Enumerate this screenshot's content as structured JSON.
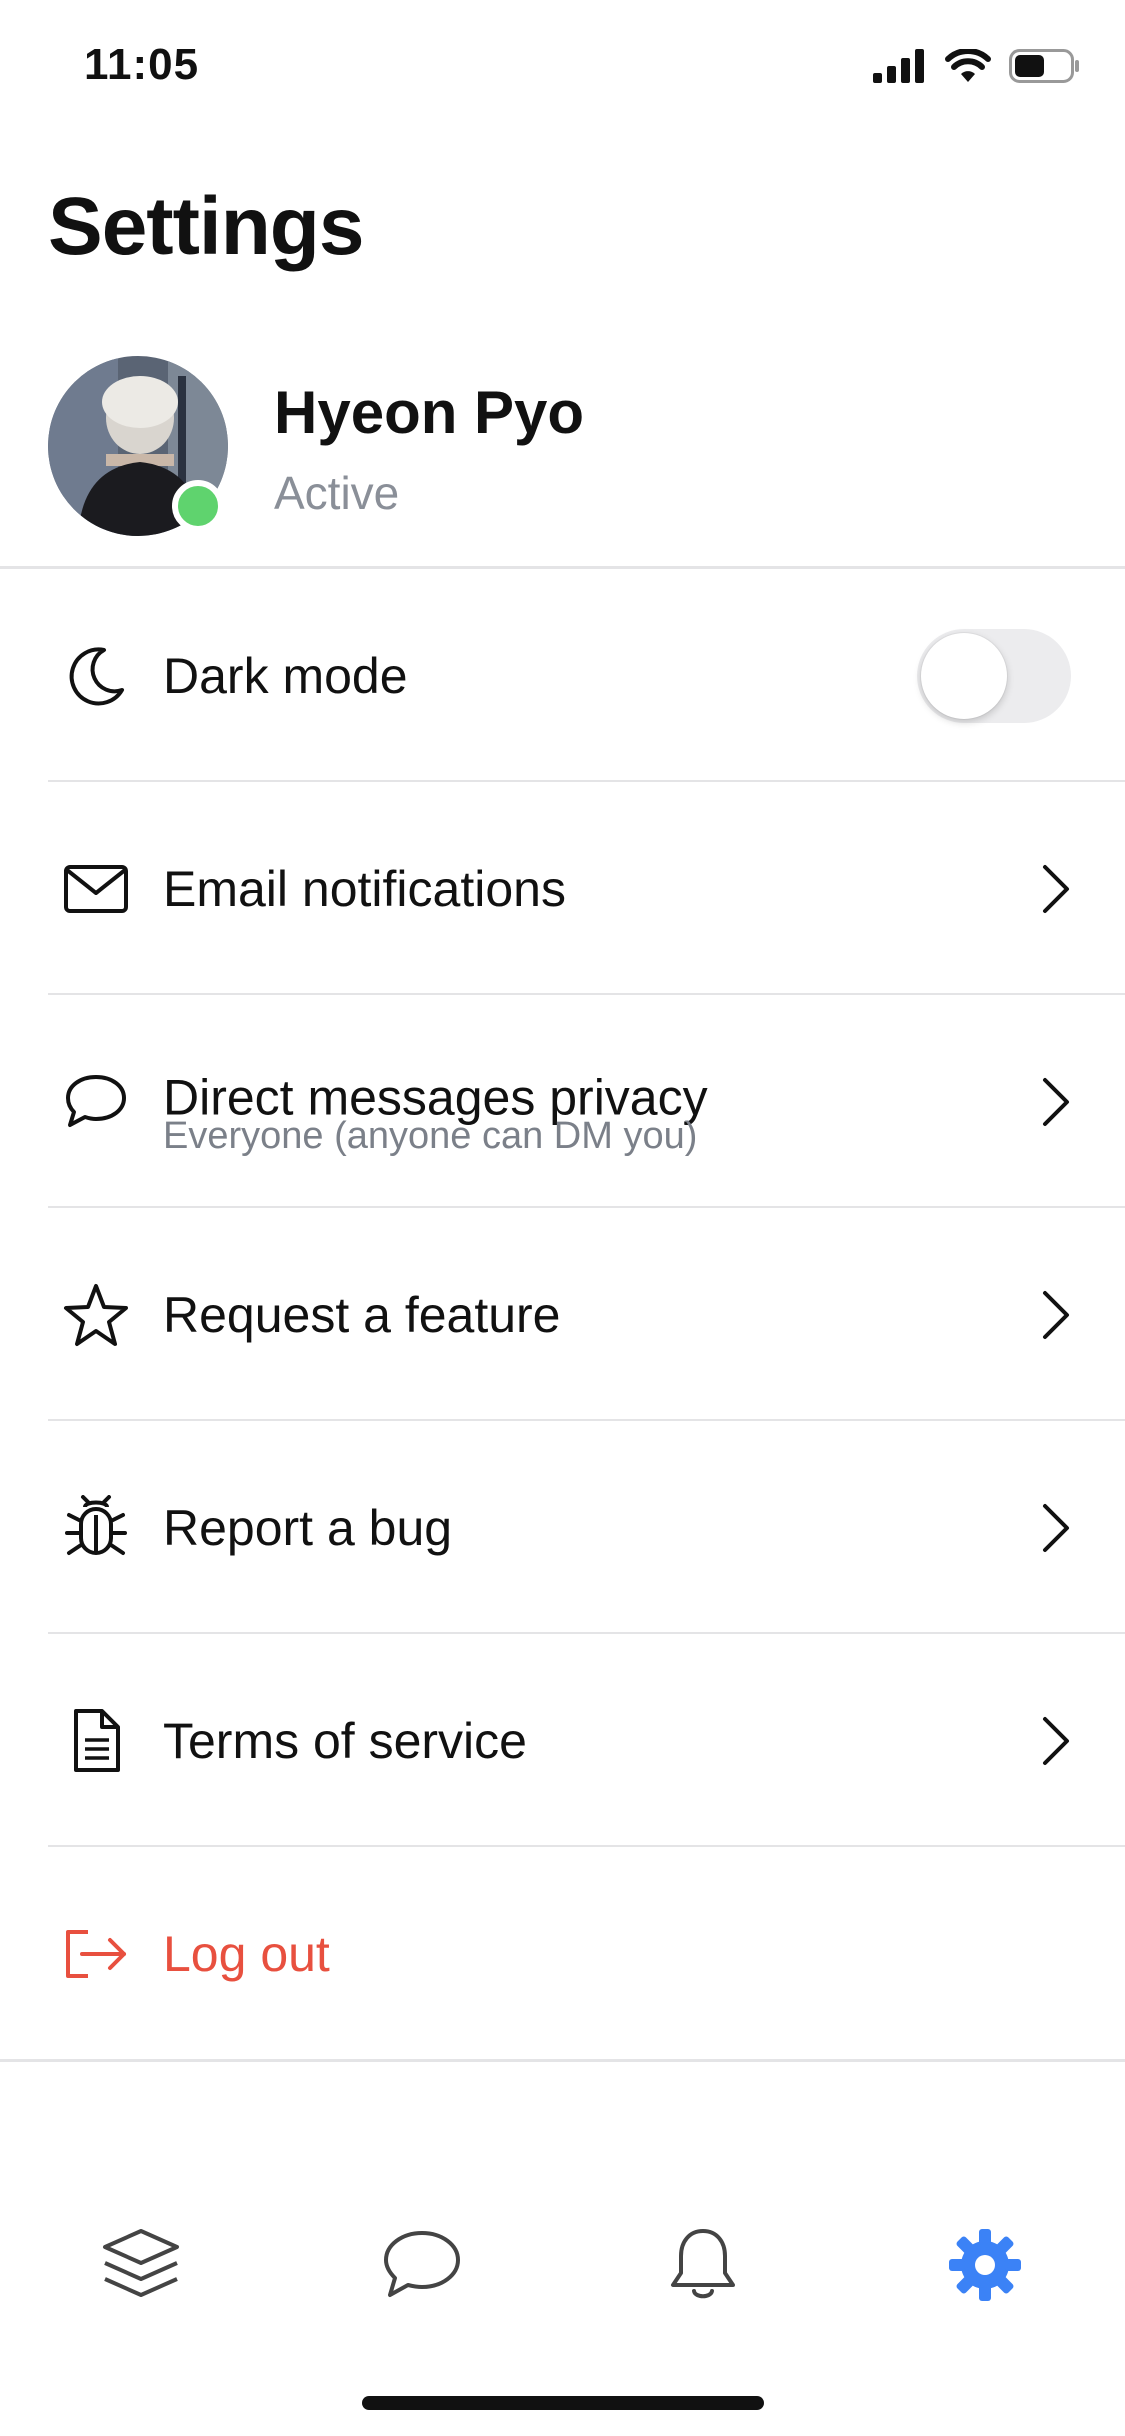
{
  "status_bar": {
    "time": "11:05",
    "battery_level": 0.55
  },
  "header": {
    "title": "Settings"
  },
  "profile": {
    "name": "Hyeon Pyo",
    "status": "Active",
    "presence_color": "#5fd36e"
  },
  "settings": {
    "dark_mode": {
      "label": "Dark mode",
      "icon": "moon-icon",
      "enabled": false
    },
    "email_notifications": {
      "label": "Email notifications",
      "icon": "envelope-icon"
    },
    "dm_privacy": {
      "label": "Direct messages privacy",
      "value": "Everyone (anyone can DM you)",
      "icon": "chat-bubble-icon"
    },
    "request_feature": {
      "label": "Request a feature",
      "icon": "star-icon"
    },
    "report_bug": {
      "label": "Report a bug",
      "icon": "bug-icon"
    },
    "terms": {
      "label": "Terms of service",
      "icon": "document-icon"
    },
    "logout": {
      "label": "Log out",
      "icon": "logout-icon",
      "color": "#e8503f"
    }
  },
  "tab_bar": {
    "tabs": [
      {
        "icon": "layers-icon",
        "active": false
      },
      {
        "icon": "chat-bubble-icon",
        "active": false
      },
      {
        "icon": "bell-icon",
        "active": false
      },
      {
        "icon": "gear-icon",
        "active": true
      }
    ],
    "active_color": "#3b82f6",
    "inactive_color": "#444444"
  }
}
